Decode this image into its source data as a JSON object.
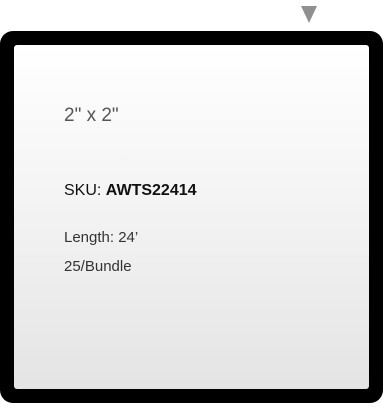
{
  "product": {
    "size": "2\" x 2\"",
    "sku_label": "SKU:",
    "sku_value": "AWTS22414",
    "length": "Length: 24’",
    "bundle": "25/Bundle"
  },
  "icons": {
    "top_arrow": "triangle-down-icon",
    "bottom_arrow": "triangle-up-icon"
  },
  "colors": {
    "frame": "#000000",
    "arrow": "#909090",
    "text": "#111111"
  }
}
